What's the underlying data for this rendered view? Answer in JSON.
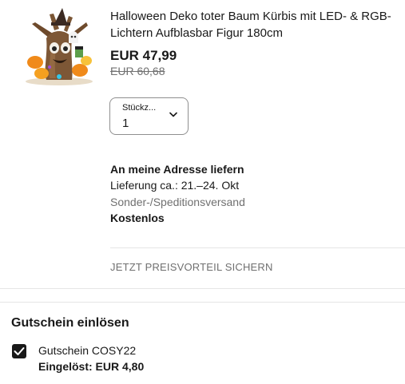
{
  "item": {
    "image_icon": "inflatable-halloween-tree-image",
    "title": "Halloween Deko toter Baum Kürbis mit LED- & RGB-Lichtern Aufblasbar Figur 180cm",
    "price": "EUR 47,99",
    "original_price": "EUR 60,68"
  },
  "quantity": {
    "label": "Stückz...",
    "value": "1"
  },
  "shipping": {
    "heading": "An meine Adresse liefern",
    "delivery": "Lieferung ca.: 21.–24. Okt",
    "method": "Sonder-/Speditionsversand",
    "cost": "Kostenlos"
  },
  "promo": {
    "label": "JETZT PREISVORTEIL SICHERN"
  },
  "coupon": {
    "heading": "Gutschein einlösen",
    "name": "Gutschein COSY22",
    "redeemed": "Eingelöst: EUR 4,80",
    "checked": true
  },
  "colors": {
    "text": "#191919",
    "muted": "#707070",
    "divider": "#e5e5e5"
  }
}
